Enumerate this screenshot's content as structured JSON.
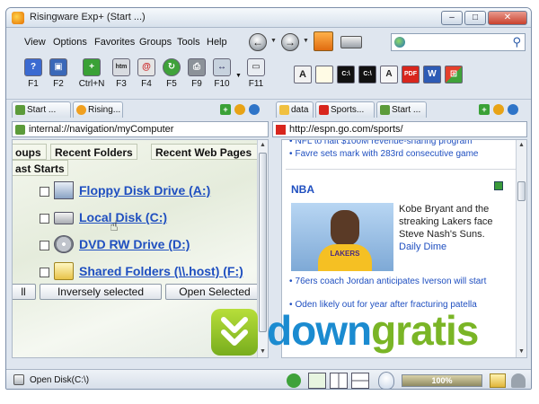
{
  "window": {
    "title": "Risingware Exp+  (Start ...)",
    "buttons": {
      "minimize": "–",
      "maximize": "□",
      "close": "✕"
    }
  },
  "menu": [
    "View",
    "Options",
    "Favorites",
    "Groups",
    "Tools",
    "Help"
  ],
  "nav": {
    "back": "←",
    "forward": "→",
    "dropdown": "▼",
    "search_placeholder": ""
  },
  "toolbar": {
    "buttons": [
      {
        "label": "F1",
        "icon": "help-icon",
        "color": "#3b6ad1",
        "glyph": "?"
      },
      {
        "label": "F2",
        "icon": "save-icon",
        "color": "#3a68b8",
        "glyph": "▣"
      },
      {
        "label": "Ctrl+N",
        "icon": "new-icon",
        "color": "#3aa136",
        "glyph": "+"
      },
      {
        "label": "F3",
        "icon": "html-icon",
        "color": "#d8dbe0",
        "glyph": "htm"
      },
      {
        "label": "F4",
        "icon": "email-icon",
        "color": "#e5e5e5",
        "glyph": "@"
      },
      {
        "label": "F5",
        "icon": "refresh-icon",
        "color": "#3fa23a",
        "glyph": "↻"
      },
      {
        "label": "F9",
        "icon": "print-icon",
        "color": "#8c9299",
        "glyph": "⎙"
      },
      {
        "label": "F10",
        "icon": "fit-icon",
        "color": "#c7d2de",
        "glyph": "↔"
      },
      {
        "label": "F11",
        "icon": "fullscreen-icon",
        "color": "#e8ecf1",
        "glyph": "▭"
      }
    ],
    "right_icons": [
      "A",
      "",
      "C:\\",
      "C:\\",
      "A",
      "PDF",
      "W",
      "⊞"
    ]
  },
  "left": {
    "tabs": [
      "Start ...",
      "Rising..."
    ],
    "address": "internal://navigation/myComputer",
    "subtabs": [
      "oups",
      "Recent Folders",
      "Recent Web Pages",
      "ast Starts"
    ],
    "drives": [
      "Floppy Disk Drive (A:)",
      "Local Disk (C:)",
      "DVD RW Drive (D:)",
      "Shared Folders (\\\\.host) (F:)"
    ],
    "buttons": [
      "ll",
      "Inversely selected",
      "Open Selected"
    ]
  },
  "right": {
    "tabs": [
      "data",
      "Sports...",
      "Start ..."
    ],
    "address": "http://espn.go.com/sports/",
    "headlines_top": [
      "NFL to halt $100M revenue-sharing program",
      "Favre sets mark with 283rd consecutive game"
    ],
    "section": "NBA",
    "photo_jersey": "LAKERS",
    "caption": "Kobe Bryant and the streaking Lakers face Steve Nash's Suns.",
    "caption_link": "Daily Dime",
    "headlines_bottom": [
      "76ers coach Jordan anticipates Iverson will start",
      "Oden likely out for year after fracturing patella"
    ]
  },
  "status": {
    "text": "Open Disk(C:\\)",
    "progress_text": "100%",
    "progress_value": 1.0
  },
  "watermark": {
    "part1": "down",
    "part2": "gratis"
  }
}
